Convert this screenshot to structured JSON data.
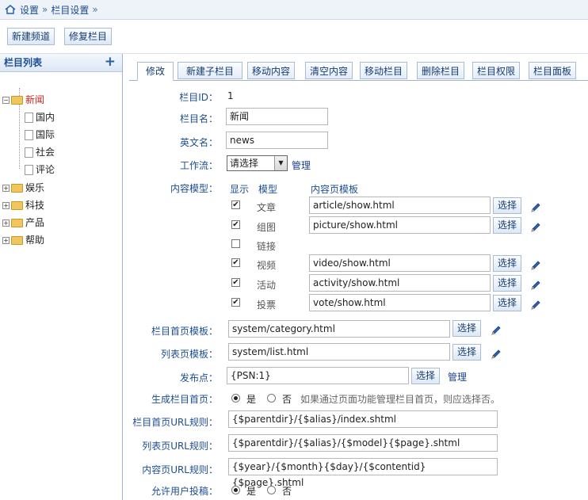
{
  "breadcrumb": {
    "home": "设置",
    "sep1": "»",
    "current": "栏目设置",
    "sep2": "»"
  },
  "toolbar": {
    "new_channel": "新建频道",
    "repair": "修复栏目"
  },
  "sidebar": {
    "title": "栏目列表",
    "add": "+",
    "tree": [
      {
        "label": "新闻",
        "expanded": true
      },
      {
        "label": "国内"
      },
      {
        "label": "国际"
      },
      {
        "label": "社会"
      },
      {
        "label": "评论"
      },
      {
        "label": "娱乐"
      },
      {
        "label": "科技"
      },
      {
        "label": "产品"
      },
      {
        "label": "帮助"
      }
    ]
  },
  "tabs": [
    "修改",
    "新建子栏目",
    "移动内容",
    "清空内容",
    "移动栏目",
    "删除栏目",
    "栏目权限",
    "栏目面板"
  ],
  "form": {
    "id_label": "栏目ID：",
    "id_value": "1",
    "name_label": "栏目名：",
    "name_value": "新闻",
    "en_label": "英文名：",
    "en_value": "news",
    "workflow_label": "工作流：",
    "workflow_value": "请选择",
    "workflow_manage": "管理",
    "model_label": "内容模型：",
    "model_headers": {
      "show": "显示",
      "model": "模型",
      "tpl": "内容页模板"
    },
    "models": [
      {
        "name": "文章",
        "checked": true,
        "tpl": "article/show.html",
        "btn": "选择"
      },
      {
        "name": "组图",
        "checked": true,
        "tpl": "picture/show.html",
        "btn": "选择"
      },
      {
        "name": "链接",
        "checked": false
      },
      {
        "name": "视频",
        "checked": true,
        "tpl": "video/show.html",
        "btn": "选择"
      },
      {
        "name": "活动",
        "checked": true,
        "tpl": "activity/show.html",
        "btn": "选择"
      },
      {
        "name": "投票",
        "checked": true,
        "tpl": "vote/show.html",
        "btn": "选择"
      }
    ],
    "home_tpl_label": "栏目首页模板：",
    "home_tpl_value": "system/category.html",
    "home_tpl_btn": "选择",
    "list_tpl_label": "列表页模板：",
    "list_tpl_value": "system/list.html",
    "list_tpl_btn": "选择",
    "psn_label": "发布点：",
    "psn_value": "{PSN:1}",
    "psn_btn": "选择",
    "psn_manage": "管理",
    "gen_label": "生成栏目首页：",
    "gen_yes": "是",
    "gen_no": "否",
    "gen_hint": "如果通过页面功能管理栏目首页，则应选择否。",
    "home_url_label": "栏目首页URL规则：",
    "home_url_value": "{$parentdir}/{$alias}/index.shtml",
    "list_url_label": "列表页URL规则：",
    "list_url_value": "{$parentdir}/{$alias}/{$model}{$page}.shtml",
    "content_url_label": "内容页URL规则：",
    "content_url_value": "{$year}/{$month}{$day}/{$contentid}{$page}.shtml",
    "allow_label": "允许用户投稿：",
    "allow_yes": "是",
    "allow_no": "否"
  },
  "colors": {
    "accent": "#1d4d8f",
    "active_node": "#d4261d"
  }
}
